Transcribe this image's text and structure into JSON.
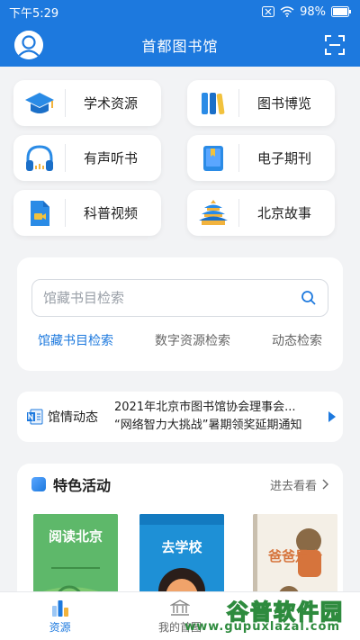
{
  "status": {
    "time": "下午5:29",
    "battery": "98%"
  },
  "header": {
    "title": "首都图书馆"
  },
  "tiles": [
    {
      "label": "学术资源",
      "icon": "graduation-cap-icon"
    },
    {
      "label": "图书博览",
      "icon": "books-icon"
    },
    {
      "label": "有声听书",
      "icon": "headphones-icon"
    },
    {
      "label": "电子期刊",
      "icon": "ebook-icon"
    },
    {
      "label": "科普视频",
      "icon": "video-icon"
    },
    {
      "label": "北京故事",
      "icon": "temple-of-heaven-icon"
    }
  ],
  "search": {
    "placeholder": "馆藏书目检索",
    "tabs": [
      "馆藏书目检索",
      "数字资源检索",
      "动态检索"
    ],
    "active_tab": 0
  },
  "news": {
    "tag": "馆情动态",
    "items": [
      "2021年北京市图书馆协会理事会...",
      "“网络智力大挑战”暑期领奖延期通知"
    ]
  },
  "features": {
    "title": "特色活动",
    "more": "进去看看",
    "books": [
      {
        "title": "阅读北京",
        "color": "#5eb86a"
      },
      {
        "title": "去学校",
        "color": "#1e90d6"
      },
      {
        "title": "爸爸是个",
        "color": "#f4efe6"
      }
    ]
  },
  "tabbar": {
    "items": [
      {
        "label": "资源",
        "active": true
      },
      {
        "label": "我的首图",
        "active": false
      }
    ]
  },
  "watermark": {
    "name": "谷普软件园",
    "url": "www.gupuxlazal.com"
  },
  "colors": {
    "primary": "#1d79de",
    "watermark": "#2e8b3e"
  }
}
